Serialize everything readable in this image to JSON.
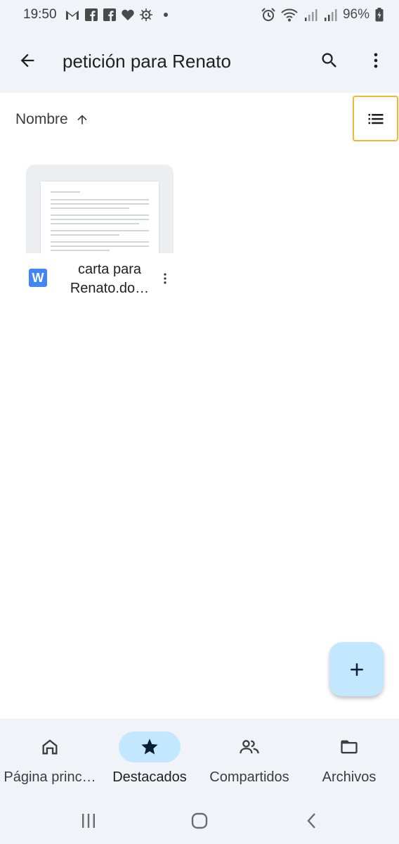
{
  "status_bar": {
    "time": "19:50",
    "battery": "96%",
    "left_icons": [
      "gmail-icon",
      "facebook-icon",
      "facebook-icon",
      "heart-icon",
      "virus-icon"
    ],
    "right_icons": [
      "alarm-icon",
      "wifi-icon",
      "signal-icon",
      "signal-icon",
      "battery-charging-icon"
    ]
  },
  "app_bar": {
    "title": "petición para Renato",
    "back_icon": "arrow-back-icon",
    "search_icon": "search-icon",
    "more_icon": "more-vert-icon"
  },
  "sort": {
    "label": "Nombre",
    "direction_icon": "arrow-up-icon",
    "view_toggle_icon": "list-view-icon"
  },
  "files": [
    {
      "name_line1": "carta para",
      "name_line2": "Renato.do…",
      "type_icon": "word-doc-icon",
      "type_letter": "W"
    }
  ],
  "fab": {
    "icon": "plus-icon"
  },
  "bottom_nav": {
    "items": [
      {
        "label": "Página princ…",
        "icon": "home-icon",
        "active": false
      },
      {
        "label": "Destacados",
        "icon": "star-icon",
        "active": true
      },
      {
        "label": "Compartidos",
        "icon": "people-icon",
        "active": false
      },
      {
        "label": "Archivos",
        "icon": "folder-icon",
        "active": false
      }
    ]
  },
  "colors": {
    "surface": "#f0f4f9",
    "accent_container": "#c2e7ff",
    "focus_outline": "#f2b632",
    "word_blue": "#4285f4"
  }
}
